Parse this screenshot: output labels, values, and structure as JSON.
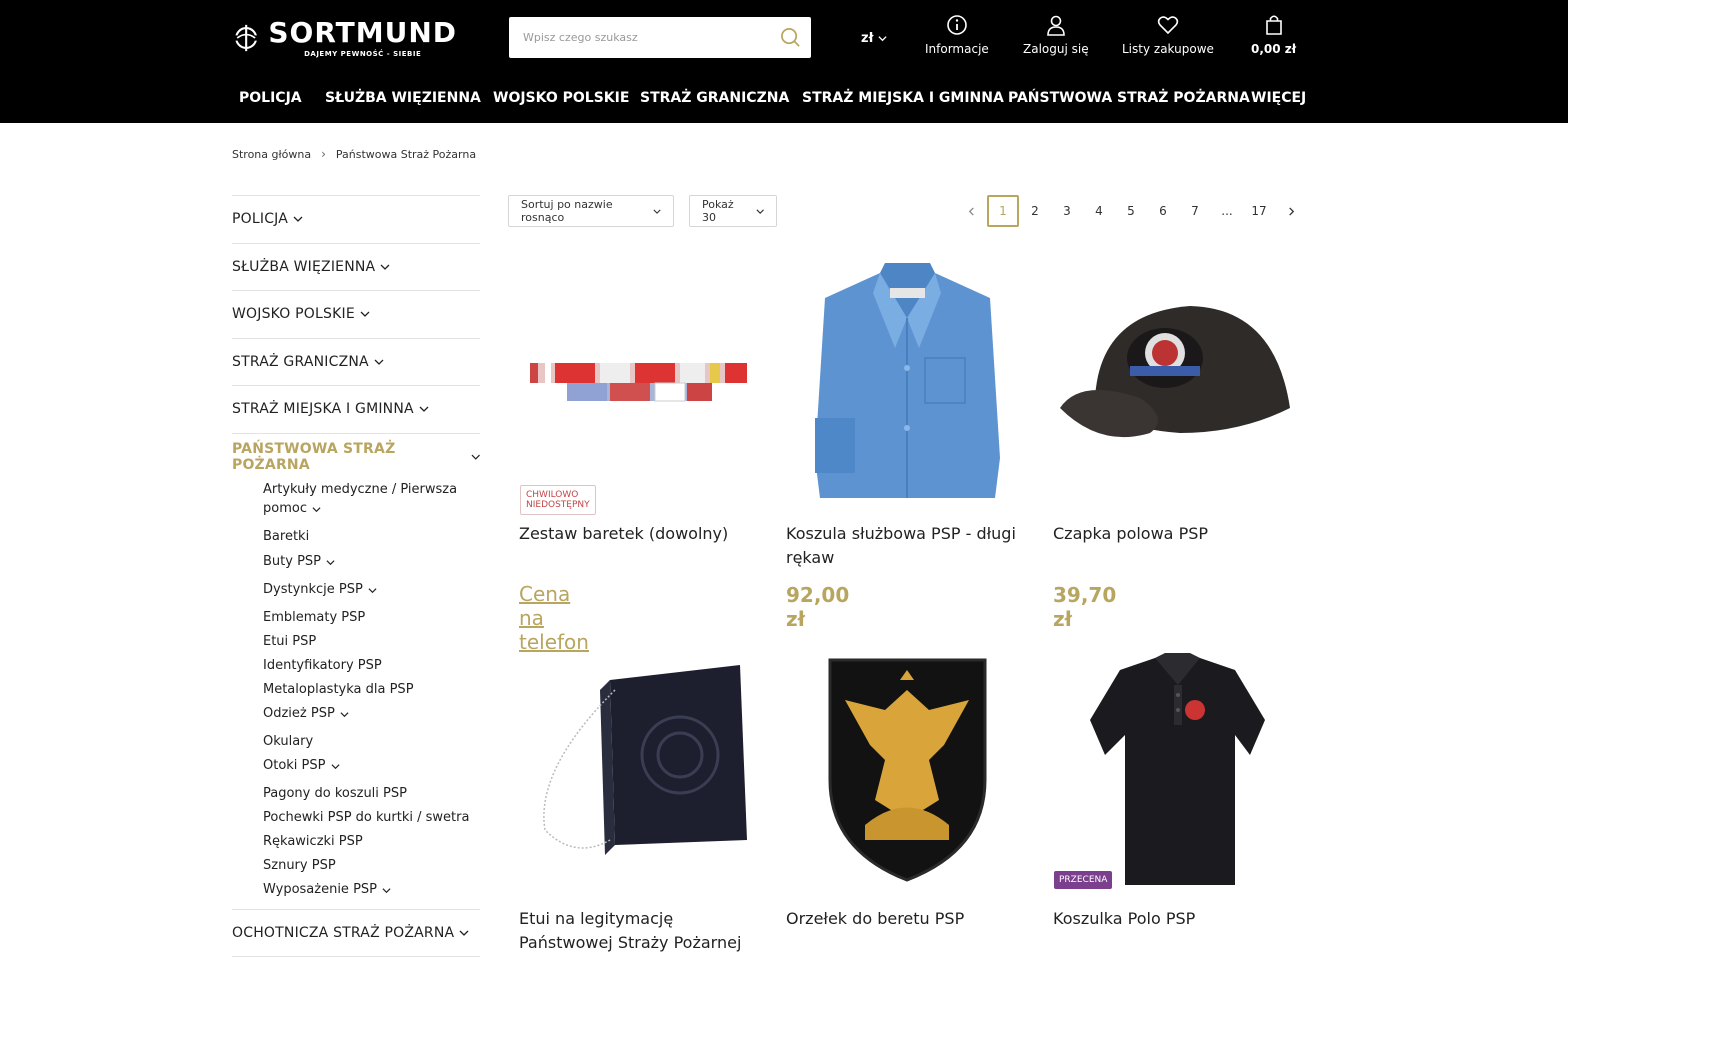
{
  "header": {
    "logo": {
      "name": "SORTMUND",
      "tagline": "DAJEMY PEWNOŚĆ - SIEBIE"
    },
    "search": {
      "placeholder": "Wpisz czego szukasz"
    },
    "currency": "zł",
    "info_label": "Informacje",
    "login_label": "Zaloguj się",
    "lists_label": "Listy zakupowe",
    "cart_label": "0,00 zł"
  },
  "mainnav": [
    "POLICJA",
    "SŁUŻBA WIĘZIENNA",
    "WOJSKO POLSKIE",
    "STRAŻ GRANICZNA",
    "STRAŻ MIEJSKA I GMINNA",
    "PAŃSTWOWA STRAŻ POŻARNA",
    "WIĘCEJ"
  ],
  "breadcrumb": [
    "Strona główna",
    "Państwowa Straż Pożarna"
  ],
  "sidebar": {
    "categories": [
      "POLICJA",
      "SŁUŻBA WIĘZIENNA",
      "WOJSKO POLSKIE",
      "STRAŻ GRANICZNA",
      "STRAŻ MIEJSKA I GMINNA"
    ],
    "active": "PAŃSTWOWA STRAŻ POŻARNA",
    "subcategories": [
      "Artykuły medyczne / Pierwsza",
      "pomoc",
      "Baretki",
      "Buty PSP",
      "Dystynkcje PSP",
      "Emblematy PSP",
      "Etui PSP",
      "Identyfikatory PSP",
      "Metaloplastyka dla PSP",
      "Odzież PSP",
      "Okulary",
      "Otoki PSP",
      "Pagony do koszuli PSP",
      "Pochewki PSP do kurtki / swetra",
      "Rękawiczki PSP",
      "Sznury PSP",
      "Wyposażenie PSP"
    ],
    "after": "OCHOTNICZA STRAŻ POŻARNA"
  },
  "toolbar": {
    "sort": "Sortuj po nazwie rosnąco",
    "show": "Pokaż 30",
    "pages": [
      "1",
      "2",
      "3",
      "4",
      "5",
      "6",
      "7",
      "...",
      "17"
    ],
    "current_page": "1"
  },
  "products": [
    {
      "title": "Zestaw baretek (dowolny)",
      "price": "Cena na telefon",
      "badge": "CHWILOWO NIEDOSTĘPNY"
    },
    {
      "title": "Koszula służbowa PSP - długi rękaw",
      "price": "92,00 zł",
      "badge": ""
    },
    {
      "title": "Czapka polowa PSP",
      "price": "39,70 zł",
      "badge": ""
    },
    {
      "title": "Etui na legitymację Państwowej Straży Pożarnej",
      "price": "",
      "badge": ""
    },
    {
      "title": "Orzełek do beretu PSP",
      "price": "",
      "badge": ""
    },
    {
      "title": "Koszulka Polo PSP",
      "price": "",
      "badge": "PRZECENA"
    }
  ],
  "colors": {
    "accent": "#b8a55f",
    "header_bg": "#000000",
    "sale_badge": "#7b3f8e",
    "unavailable_badge": "#c0474a"
  },
  "icons": [
    "search-icon",
    "info-icon",
    "user-icon",
    "heart-icon",
    "bag-icon",
    "chevron-down-icon",
    "chevron-left-icon",
    "chevron-right-icon"
  ]
}
